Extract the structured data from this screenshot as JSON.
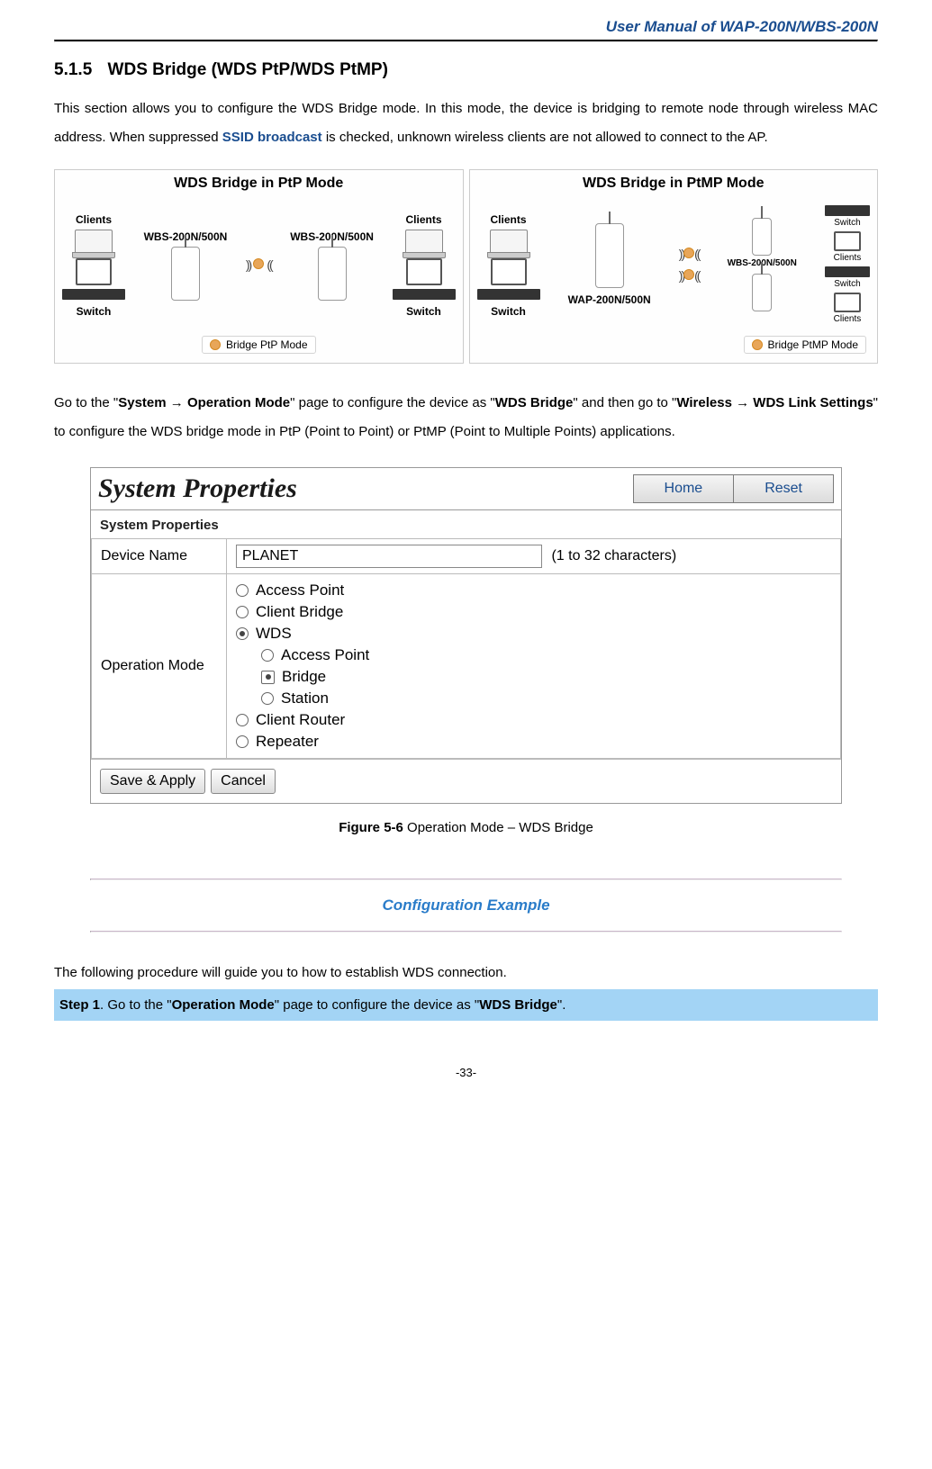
{
  "header": {
    "manual_title": "User Manual of WAP-200N/WBS-200N"
  },
  "section": {
    "number": "5.1.5",
    "title": "WDS Bridge (WDS PtP/WDS PtMP)"
  },
  "intro": {
    "part1": "This section allows you to configure the WDS Bridge mode. In this mode, the device is bridging to remote node through wireless MAC address. When suppressed ",
    "ssid": "SSID broadcast",
    "part2": " is checked, unknown wireless clients are not allowed to connect to the AP."
  },
  "diagram": {
    "left": {
      "title": "WDS Bridge in PtP Mode",
      "dev1": "WBS-200N/500N",
      "dev2": "WBS-200N/500N",
      "clients": "Clients",
      "switch": "Switch",
      "mode": "Bridge PtP Mode"
    },
    "right": {
      "title": "WDS Bridge in PtMP Mode",
      "clients": "Clients",
      "switch": "Switch",
      "dev_top": "WBS-200N/500N",
      "dev_bottom": "WAP-200N/500N",
      "mode": "Bridge PtMP Mode"
    }
  },
  "nav": {
    "p1": "Go to the \"",
    "system": "System",
    "arrow": " → ",
    "opmode": "Operation Mode",
    "p2": "\" page to configure the device as \"",
    "wdsbridge": "WDS Bridge",
    "p3": "\" and then go to \"",
    "wireless": "Wireless",
    "wdslink": "WDS Link Settings",
    "p4": "\" to configure the WDS bridge mode in PtP (Point to Point) or PtMP (Point to Multiple Points) applications."
  },
  "sysprops": {
    "title": "System Properties",
    "home": "Home",
    "reset": "Reset",
    "section": "System Properties",
    "devname_label": "Device Name",
    "devname_value": "PLANET",
    "devname_hint": "(1 to 32 characters)",
    "opmode_label": "Operation Mode",
    "modes": {
      "ap": "Access Point",
      "cb": "Client Bridge",
      "wds": "WDS",
      "wds_ap": "Access Point",
      "wds_bridge": "Bridge",
      "wds_station": "Station",
      "cr": "Client Router",
      "rep": "Repeater"
    },
    "save": "Save & Apply",
    "cancel": "Cancel"
  },
  "figure": {
    "label": "Figure 5-6",
    "text": " Operation Mode – WDS Bridge"
  },
  "config_example": "Configuration Example",
  "following": "The following procedure will guide you to how to establish WDS connection.",
  "step1": {
    "step": "Step 1",
    "p1": ". Go to the \"",
    "opmode": "Operation Mode",
    "p2": "\" page to configure the device as \"",
    "wdsbridge": "WDS Bridge",
    "p3": "\"."
  },
  "page_number": "-33-"
}
